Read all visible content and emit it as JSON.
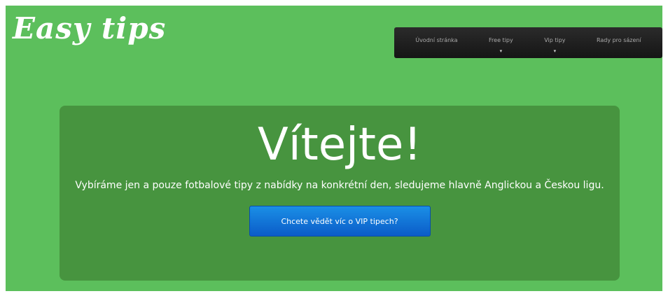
{
  "brand": {
    "logo_text": "Easy tips"
  },
  "nav": {
    "items": [
      {
        "label": "Úvodní stránka",
        "has_dropdown": false
      },
      {
        "label": "Free tipy",
        "has_dropdown": true
      },
      {
        "label": "Vip tipy",
        "has_dropdown": true
      },
      {
        "label": "Rady pro sázení",
        "has_dropdown": false
      }
    ],
    "dropdown_caret": "▾"
  },
  "hero": {
    "title": "Vítejte!",
    "text": "Vybíráme jen a pouze fotbalové tipy z nabídky na konkrétní den, sledujeme hlavně Anglickou a Českou ligu.",
    "button_label": "Chcete vědět víc o VIP tipech?"
  },
  "colors": {
    "page_background": "#5cbf5c",
    "hero_background": "#47943f",
    "nav_background": "#1f1f1f",
    "button": "#0f6fd6"
  }
}
